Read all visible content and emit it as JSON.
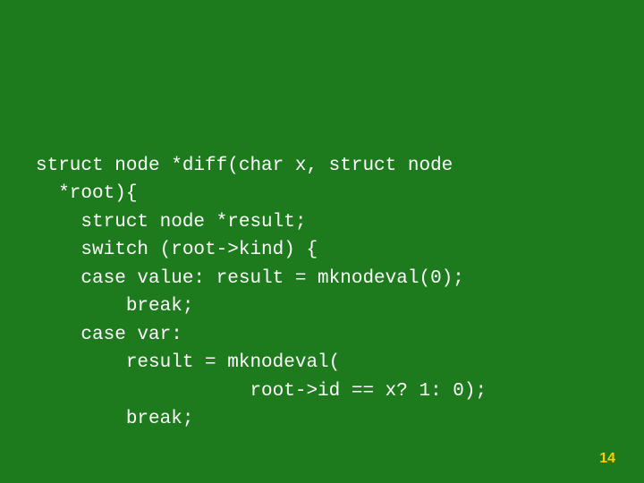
{
  "code": {
    "line1": "struct node *diff(char x, struct node",
    "line2": "  *root){",
    "line3": "    struct node *result;",
    "line4": "    switch (root->kind) {",
    "line5": "    case value: result = mknodeval(0);",
    "line6": "        break;",
    "line7": "    case var:",
    "line8": "        result = mknodeval(",
    "line9": "                   root->id == x? 1: 0);",
    "line10": "        break;"
  },
  "page_number": "14"
}
